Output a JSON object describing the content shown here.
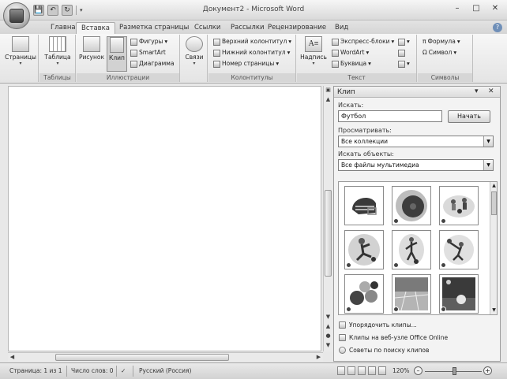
{
  "window": {
    "title": "Документ2 - Microsoft Word"
  },
  "qat": {
    "save": "💾",
    "undo": "↶",
    "redo": "↻",
    "customize": "▾"
  },
  "window_controls": {
    "minimize": "–",
    "maximize": "□",
    "close": "✕"
  },
  "tabs": [
    {
      "label": "Главная",
      "active": false
    },
    {
      "label": "Вставка",
      "active": true
    },
    {
      "label": "Разметка страницы",
      "active": false
    },
    {
      "label": "Ссылки",
      "active": false
    },
    {
      "label": "Рассылки",
      "active": false
    },
    {
      "label": "Рецензирование",
      "active": false
    },
    {
      "label": "Вид",
      "active": false
    }
  ],
  "help": "?",
  "ribbon": {
    "pages": {
      "label": "Страницы"
    },
    "tables": {
      "label": "Таблица",
      "group": "Таблицы"
    },
    "illustrations": {
      "group": "Иллюстрации",
      "picture": "Рисунок",
      "clip": "Клип",
      "shapes": "Фигуры",
      "smartart": "SmartArt",
      "chart": "Диаграмма"
    },
    "links": {
      "label": "Связи"
    },
    "headers": {
      "group": "Колонтитулы",
      "header": "Верхний колонтитул",
      "footer": "Нижний колонтитул",
      "page_number": "Номер страницы"
    },
    "text": {
      "group": "Текст",
      "textbox": "Надпись",
      "quick_parts": "Экспресс-блоки",
      "wordart": "WordArt",
      "dropcap": "Буквица"
    },
    "symbols": {
      "group": "Символы",
      "equation": "Формула",
      "symbol": "Символ"
    }
  },
  "pane": {
    "title": "Клип",
    "search_label": "Искать:",
    "search_value": "Футбол",
    "go_button": "Начать",
    "browse_label": "Просматривать:",
    "browse_value": "Все коллекции",
    "type_label": "Искать объекты:",
    "type_value": "Все файлы мультимедиа",
    "links": [
      "Упорядочить клипы...",
      "Клипы на веб-узле Office Online",
      "Советы по поиску клипов"
    ]
  },
  "status": {
    "page": "Страница: 1 из 1",
    "words": "Число слов: 0",
    "language": "Русский (Россия)",
    "zoom": "120%",
    "zoom_percent": 120
  },
  "colors": {
    "accent": "#6f8fb8",
    "ribbon": "#e4e4e4",
    "pane": "#f3f3f3"
  }
}
